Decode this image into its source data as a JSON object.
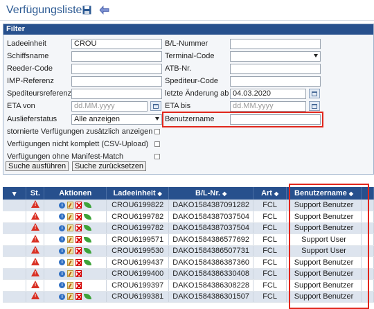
{
  "header": {
    "title": "Verfügungsliste"
  },
  "filter": {
    "title": "Filter",
    "ladeeinheit": {
      "label": "Ladeeinheit",
      "value": "CROU"
    },
    "bl_nummer": {
      "label": "B/L-Nummer",
      "value": ""
    },
    "schiffsname": {
      "label": "Schiffsname",
      "value": ""
    },
    "terminal_code": {
      "label": "Terminal-Code",
      "value": ""
    },
    "reeder_code": {
      "label": "Reeder-Code",
      "value": ""
    },
    "atb_nr": {
      "label": "ATB-Nr.",
      "value": ""
    },
    "imp_referenz": {
      "label": "IMP-Referenz",
      "value": ""
    },
    "spediteur_code": {
      "label": "Spediteur-Code",
      "value": ""
    },
    "spediteursreferenz": {
      "label": "Spediteursreferenz",
      "value": ""
    },
    "letzte_aenderung": {
      "label": "letzte Änderung ab",
      "value": "04.03.2020"
    },
    "eta_von": {
      "label": "ETA von",
      "placeholder": "dd.MM.yyyy"
    },
    "eta_bis": {
      "label": "ETA bis",
      "placeholder": "dd.MM.yyyy"
    },
    "auslieferstatus": {
      "label": "Auslieferstatus",
      "value": "Alle anzeigen"
    },
    "benutzername": {
      "label": "Benutzername",
      "value": ""
    },
    "checks": [
      "stornierte Verfügungen zusätzlich anzeigen",
      "Verfügungen nicht komplett (CSV-Upload)",
      "Verfügungen ohne Manifest-Match"
    ],
    "search_button": "Suche ausführen",
    "reset_button": "Suche zurücksetzen"
  },
  "table": {
    "columns": {
      "menu": "▾",
      "status": "St.",
      "actions": "Aktionen",
      "ladeeinheit": "Ladeeinheit",
      "bl": "B/L-Nr.",
      "art": "Art",
      "benutzername": "Benutzername"
    },
    "rows": [
      {
        "ladeeinheit": "CROU6199822",
        "bl": "DAKO1584387091282",
        "art": "FCL",
        "user": "Support Benutzer",
        "leaf": true
      },
      {
        "ladeeinheit": "CROU6199782",
        "bl": "DAKO1584387037504",
        "art": "FCL",
        "user": "Support Benutzer",
        "leaf": true
      },
      {
        "ladeeinheit": "CROU6199782",
        "bl": "DAKO1584387037504",
        "art": "FCL",
        "user": "Support Benutzer",
        "leaf": true
      },
      {
        "ladeeinheit": "CROU6199571",
        "bl": "DAKO1584386577692",
        "art": "FCL",
        "user": "Support User",
        "leaf": true
      },
      {
        "ladeeinheit": "CROU6199530",
        "bl": "DAKO1584386507731",
        "art": "FCL",
        "user": "Support User",
        "leaf": true
      },
      {
        "ladeeinheit": "CROU6199437",
        "bl": "DAKO1584386387360",
        "art": "FCL",
        "user": "Support Benutzer",
        "leaf": true
      },
      {
        "ladeeinheit": "CROU6199400",
        "bl": "DAKO1584386330408",
        "art": "FCL",
        "user": "Support Benutzer",
        "leaf": false
      },
      {
        "ladeeinheit": "CROU6199397",
        "bl": "DAKO1584386308228",
        "art": "FCL",
        "user": "Support Benutzer",
        "leaf": false
      },
      {
        "ladeeinheit": "CROU6199381",
        "bl": "DAKO1584386301507",
        "art": "FCL",
        "user": "Support Benutzer",
        "leaf": true
      }
    ]
  },
  "colors": {
    "header_blue": "#27508d",
    "highlight_red": "#e1261c",
    "row_alt": "#dde4ee"
  }
}
